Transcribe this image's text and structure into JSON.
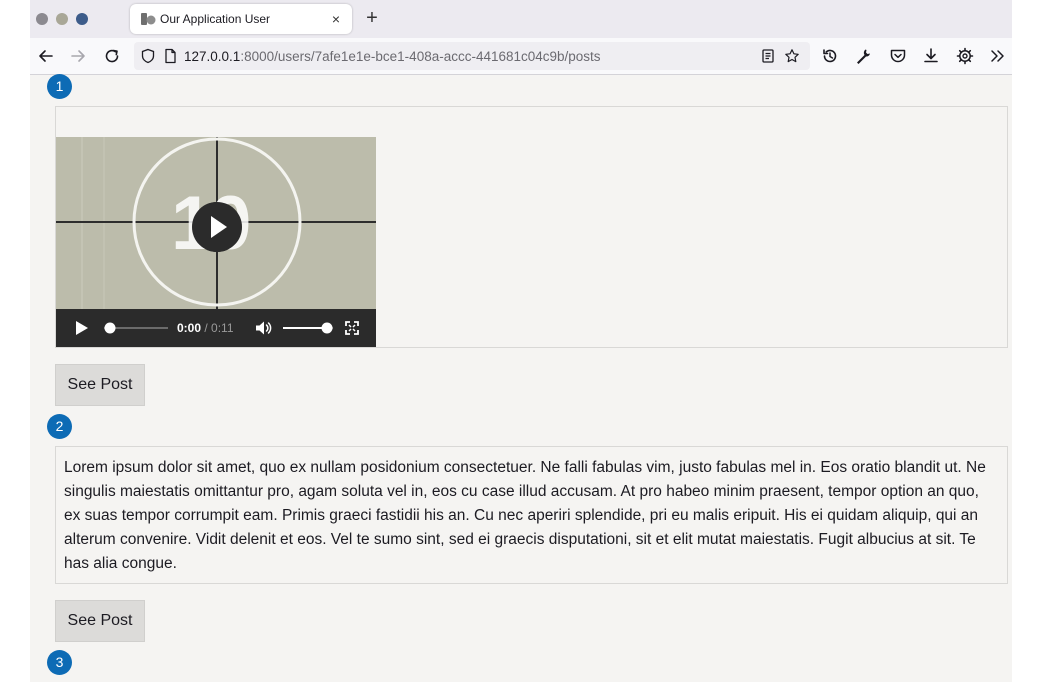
{
  "browser": {
    "tab_title": "Our Application User",
    "tab_close": "×",
    "new_tab": "+",
    "url_host": "127.0.0.1",
    "url_rest": ":8000/users/7afe1e1e-bce1-408a-accc-441681c04c9b/posts"
  },
  "posts": [
    {
      "number": "1",
      "type": "video",
      "countdown_digits": "10",
      "current_time": "0:00",
      "time_separator": " / ",
      "duration": "0:11",
      "progress": 0,
      "volume": 1.0,
      "button_label": "See Post"
    },
    {
      "number": "2",
      "type": "text",
      "text": "Lorem ipsum dolor sit amet, quo ex nullam posidonium consectetuer. Ne falli fabulas vim, justo fabulas mel in. Eos oratio blandit ut. Ne singulis maiestatis omittantur pro, agam soluta vel in, eos cu case illud accusam. At pro habeo minim praesent, tempor option an quo, ex suas tempor corrumpit eam. Primis graeci fastidii his an. Cu nec aperiri splendide, pri eu malis eripuit. His ei quidam aliquip, qui an alterum convenire. Vidit delenit et eos. Vel te sumo sint, sed ei graecis disputationi, sit et elit mutat maiestatis. Fugit albucius at sit. Te has alia congue.",
      "button_label": "See Post"
    },
    {
      "number": "3"
    }
  ],
  "colors": {
    "badge": "#0d6bb5",
    "page_bg": "#f5f4f2",
    "video_bg": "#bcbcab"
  }
}
